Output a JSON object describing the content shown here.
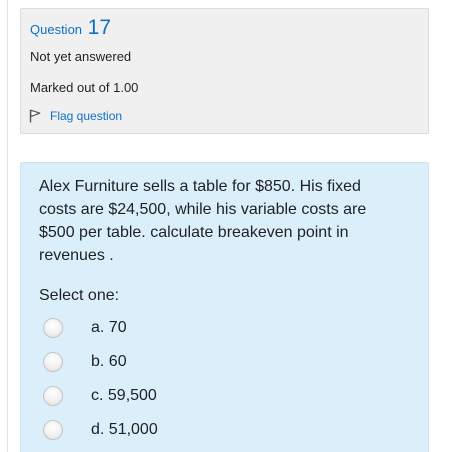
{
  "info": {
    "question_label": "Question",
    "question_number": "17",
    "state": "Not yet answered",
    "grade": "Marked out of 1.00",
    "flag_label": "Flag question"
  },
  "question": {
    "text": "Alex Furniture sells a table for $850. His fixed costs are $24,500, while his variable costs are $500 per table. calculate breakeven point in revenues .",
    "prompt": "Select one:",
    "options": [
      {
        "label": "a. 70"
      },
      {
        "label": "b. 60"
      },
      {
        "label": "c. 59,500"
      },
      {
        "label": "d. 51,000"
      }
    ]
  },
  "colors": {
    "link": "#0f6fc5",
    "info_bg": "#f0f0f0",
    "formulation_bg": "#dbeffa"
  }
}
